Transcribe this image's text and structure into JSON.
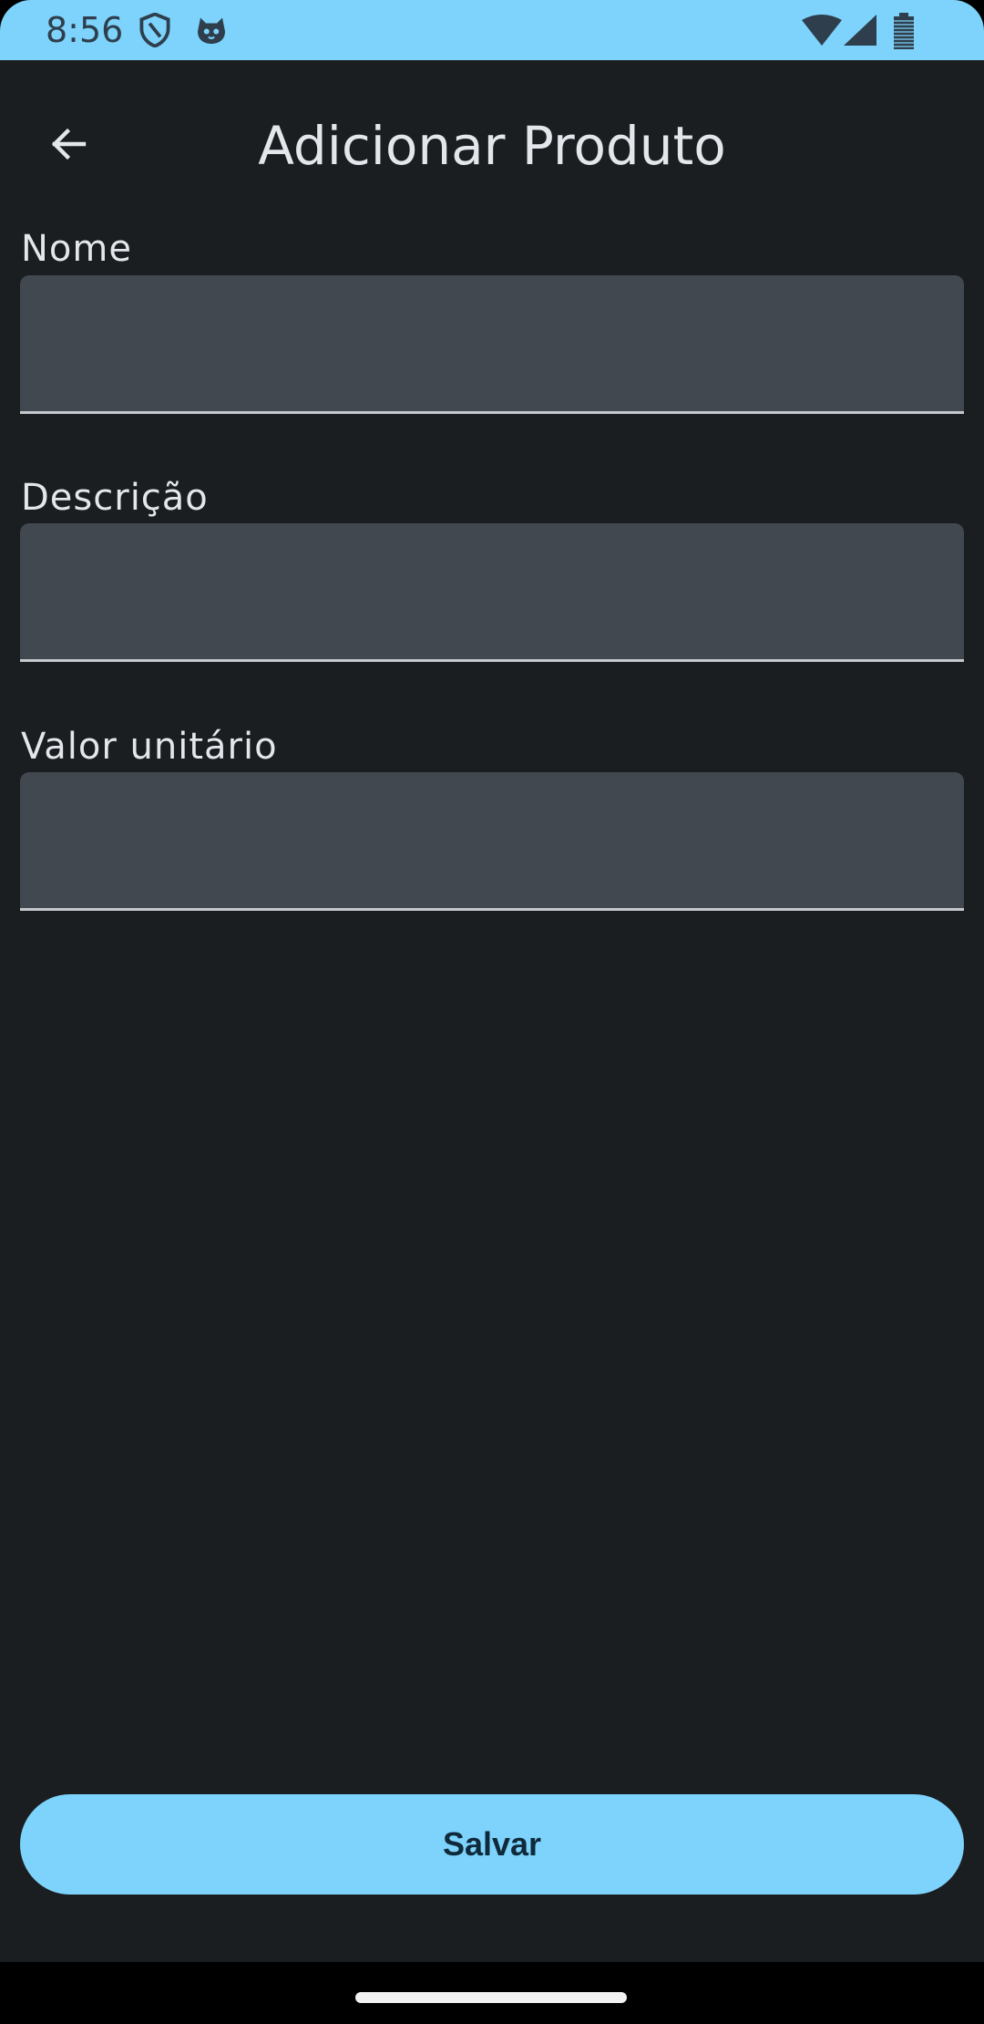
{
  "status_bar": {
    "time": "8:56",
    "background_color": "#7dd3fc",
    "icons": [
      "shield-icon",
      "cat-face-icon",
      "wifi-icon",
      "cell-signal-icon",
      "battery-icon"
    ]
  },
  "app_bar": {
    "title": "Adicionar Produto",
    "back_icon": "arrow-back-icon"
  },
  "form": {
    "fields": [
      {
        "label": "Nome",
        "value": "",
        "placeholder": ""
      },
      {
        "label": "Descrição",
        "value": "",
        "placeholder": ""
      },
      {
        "label": "Valor unitário",
        "value": "",
        "placeholder": ""
      }
    ]
  },
  "actions": {
    "save_label": "Salvar"
  },
  "colors": {
    "accent": "#7dd3fc",
    "background": "#1b1e21",
    "input_fill": "#41484f",
    "text_primary": "#e3e6ea"
  }
}
